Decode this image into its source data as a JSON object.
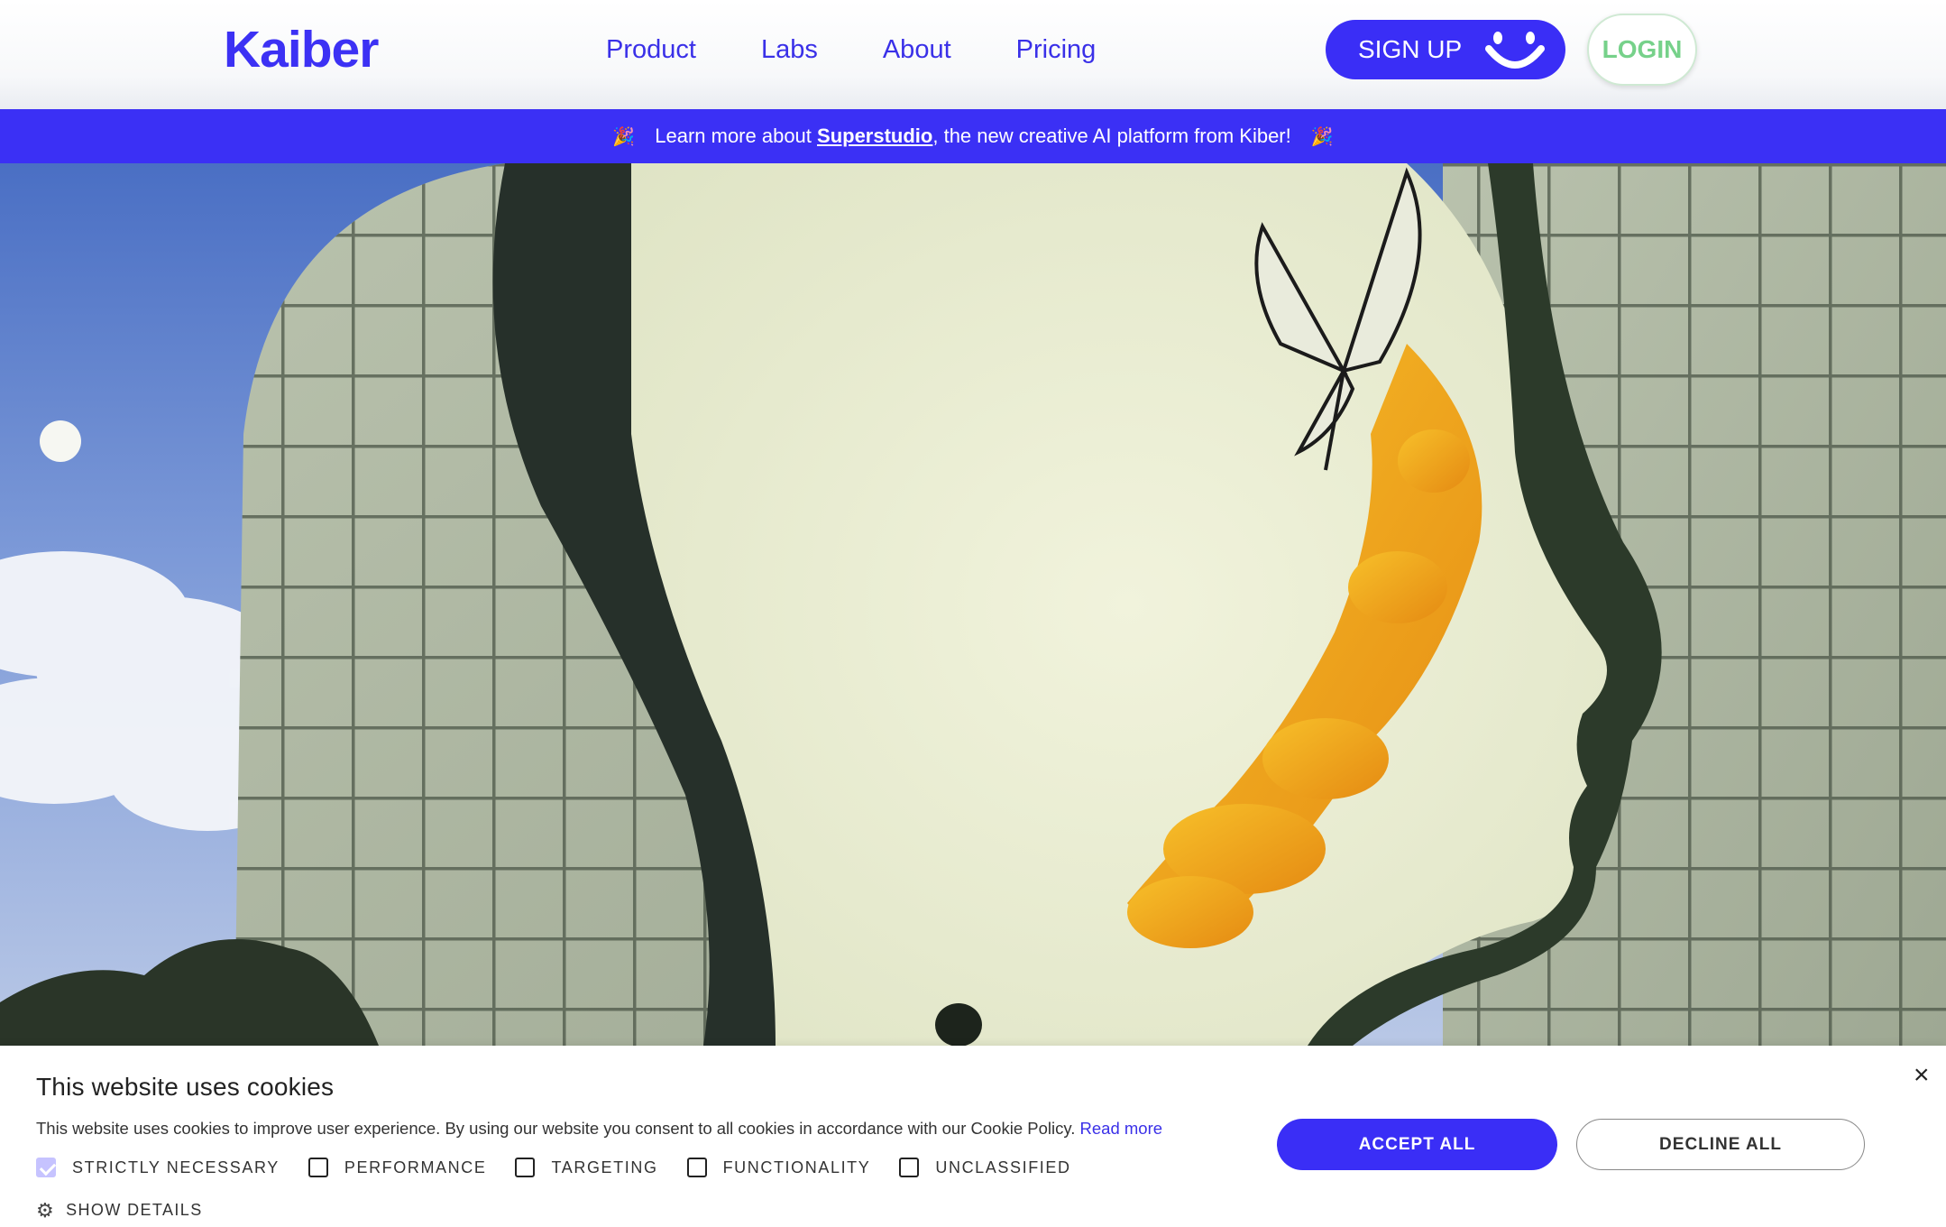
{
  "header": {
    "logo": "Kaiber",
    "nav": [
      "Product",
      "Labs",
      "About",
      "Pricing"
    ],
    "signup_label": "SIGN UP",
    "login_label": "LOGIN"
  },
  "banner": {
    "prefix": "Learn more about ",
    "link": "Superstudio",
    "suffix": ", the new creative AI platform from Kiber!",
    "emoji": "🎉"
  },
  "cookie": {
    "title": "This website uses cookies",
    "description": "This website uses cookies to improve user experience. By using our website you consent to all cookies in accordance with our Cookie Policy.",
    "read_more": "Read more",
    "options": [
      {
        "label": "STRICTLY NECESSARY",
        "checked": true
      },
      {
        "label": "PERFORMANCE",
        "checked": false
      },
      {
        "label": "TARGETING",
        "checked": false
      },
      {
        "label": "FUNCTIONALITY",
        "checked": false
      },
      {
        "label": "UNCLASSIFIED",
        "checked": false
      }
    ],
    "show_details": "SHOW DETAILS",
    "accept_label": "ACCEPT ALL",
    "decline_label": "DECLINE ALL",
    "close_icon": "×"
  },
  "colors": {
    "accent": "#3a2ef6",
    "login_text": "#76d18a"
  }
}
